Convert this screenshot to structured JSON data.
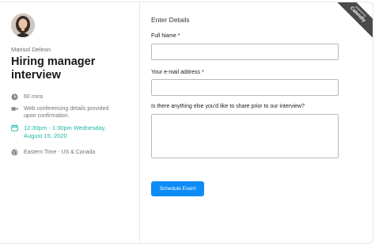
{
  "host": {
    "name": "Marisol Deleon",
    "avatar_icon": "person-photo"
  },
  "event": {
    "title": "Hiring manager interview",
    "details": [
      {
        "icon": "clock-icon",
        "text": "60 mins"
      },
      {
        "icon": "video-camera-icon",
        "text": "Web conferencing details provided upon confirmation."
      },
      {
        "icon": "calendar-icon",
        "text": "12:30pm - 1:30pm Wednesday, August 15, 2020",
        "color": "#1bb5a2"
      },
      {
        "icon": "globe-icon",
        "text": "Eastern Time - US & Canada"
      }
    ]
  },
  "form": {
    "title": "Enter Details",
    "full_name_label": "Full Name *",
    "full_name_value": "",
    "email_label": "Your e-mail address *",
    "email_value": "",
    "notes_label": "Is there anything else you'd like to share prior to our interview?",
    "notes_value": "",
    "submit_label": "Schedule Event"
  },
  "badge": {
    "powered_by": "powered by",
    "brand": "Calendly"
  },
  "colors": {
    "accent": "#0d8cf5",
    "teal": "#1bb5a2",
    "ribbon": "#4a4a4a"
  }
}
